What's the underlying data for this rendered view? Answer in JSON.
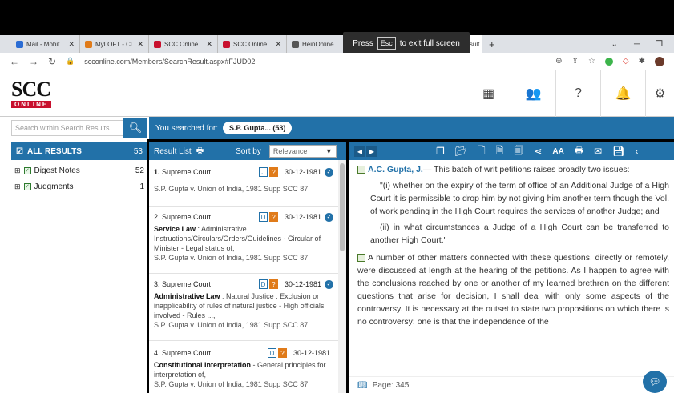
{
  "fullscreen_notice": {
    "press": "Press",
    "key": "Esc",
    "rest": "to exit full screen"
  },
  "tabs": [
    {
      "label": "Mail - Mohit",
      "color": "#2a6cd4"
    },
    {
      "label": "MyLOFT - Cl",
      "color": "#e07b1a"
    },
    {
      "label": "SCC Online",
      "color": "#c8102e"
    },
    {
      "label": "SCC Online",
      "color": "#c8102e"
    },
    {
      "label": "HeinOnline",
      "color": "#555555"
    },
    {
      "label": "SCC Search Result",
      "color": "#c8102e"
    }
  ],
  "url": "scconline.com/Members/SearchResult.aspx#FJUD02",
  "logo": {
    "top": "SCC",
    "bottom": "ONLINE"
  },
  "search": {
    "placeholder": "Search within Search Results",
    "you_searched": "You searched for:",
    "query": "S.P. Gupta... (53)"
  },
  "filters": {
    "all_label": "ALL RESULTS",
    "all_count": "53",
    "items": [
      {
        "label": "Digest Notes",
        "count": "52"
      },
      {
        "label": "Judgments",
        "count": "1"
      }
    ]
  },
  "result_list": {
    "title": "Result List",
    "sort_label": "Sort by",
    "sort_value": "Relevance",
    "results": [
      {
        "num": "1.",
        "court": "Supreme Court",
        "badge": "J",
        "date": "30-12-1981",
        "subject": "",
        "topic": "",
        "cite": "S.P. Gupta v. Union of India, 1981 Supp SCC 87"
      },
      {
        "num": "2.",
        "court": "Supreme Court",
        "badge": "D",
        "date": "30-12-1981",
        "subject": "Service Law",
        "topic": ": Administrative Instructions/Circulars/Orders/Guidelines - Circular of Minister - Legal status of,",
        "cite": "S.P. Gupta v. Union of India, 1981 Supp SCC 87"
      },
      {
        "num": "3.",
        "court": "Supreme Court",
        "badge": "D",
        "date": "30-12-1981",
        "subject": "Administrative Law",
        "topic": ": Natural Justice : Exclusion or inapplicability of rules of natural justice - High officials involved - Rules ...,",
        "cite": "S.P. Gupta v. Union of India, 1981 Supp SCC 87"
      },
      {
        "num": "4.",
        "court": "Supreme Court",
        "badge": "D",
        "date": "30-12-1981",
        "subject": "Constitutional Interpretation",
        "topic": "- General principles for interpretation of,",
        "cite": "S.P. Gupta v. Union of India, 1981 Supp SCC 87"
      }
    ]
  },
  "document": {
    "judge": "A.C. Gupta, J.",
    "para1_rest": "— This batch of writ petitions raises broadly two issues:",
    "quote1": "\"(i) whether on the expiry of the term of office of an Additional Judge of a High Court it is permissible to drop him by not giving him another term though the Vol. of work pending in the High Court requires the services of another Judge; and",
    "quote2": "(ii) in what circumstances a Judge of a High Court can be transferred to another High Court.\"",
    "para2": "A number of other matters connected with these questions, directly or remotely, were discussed at length at the hearing of the petitions. As I happen to agree with the conclusions reached by one or another of my learned brethren on the different questions that arise for decision, I shall deal with only some aspects of the controversy. It is necessary at the outset to state two propositions on which there is no controversy: one is that the independence of the",
    "page": "Page: 345"
  }
}
